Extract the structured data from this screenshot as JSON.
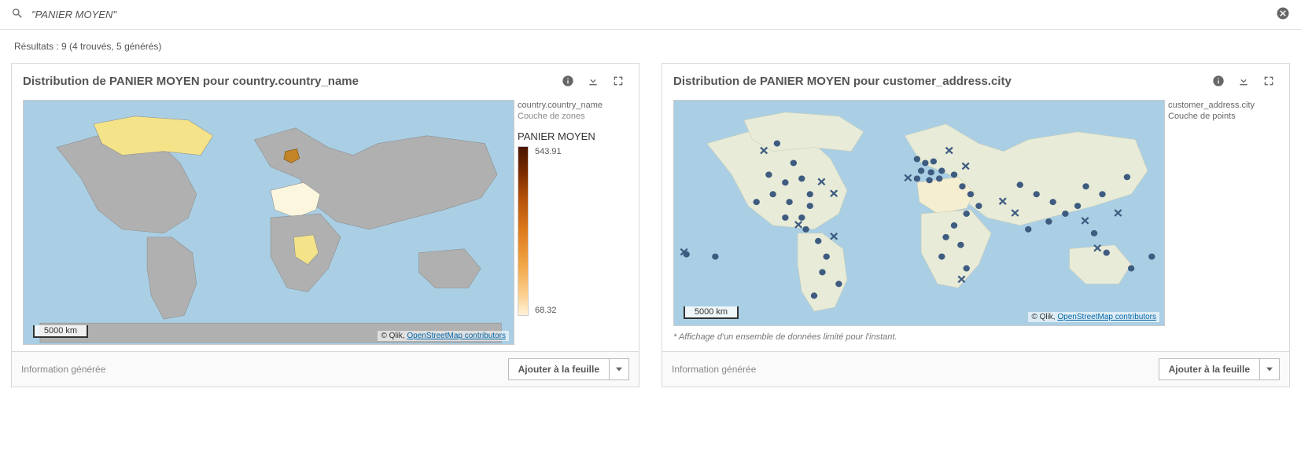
{
  "search": {
    "value": "\"PANIER MOYEN\"",
    "placeholder": ""
  },
  "results_summary": "Résultats : 9 (4 trouvés, 5 générés)",
  "cards": [
    {
      "title": "Distribution de PANIER MOYEN pour country.country_name",
      "legend": {
        "dim_label": "country.country_name",
        "layer_label": "Couche de zones",
        "measure_label": "PANIER MOYEN",
        "max": "543.91",
        "min": "68.32"
      },
      "scale_label": "5000 km",
      "attribution_prefix": "© Qlik, ",
      "attribution_link": "OpenStreetMap contributors",
      "footer_info": "Information générée",
      "footer_button": "Ajouter à la feuille"
    },
    {
      "title": "Distribution de PANIER MOYEN pour customer_address.city",
      "legend": {
        "dim_label": "customer_address.city",
        "layer_label": "Couche de points"
      },
      "scale_label": "5000 km",
      "attribution_prefix": "© Qlik, ",
      "attribution_link": "OpenStreetMap contributors",
      "footnote": "* Affichage d'un ensemble de données limité pour l'instant.",
      "footer_info": "Information générée",
      "footer_button": "Ajouter à la feuille"
    }
  ],
  "chart_data": {
    "type": "map",
    "left_map": {
      "layer": "choropleth",
      "dimension": "country.country_name",
      "measure": "PANIER MOYEN",
      "color_range": [
        68.32,
        543.91
      ]
    },
    "right_map": {
      "layer": "points",
      "dimension": "customer_address.city"
    }
  }
}
